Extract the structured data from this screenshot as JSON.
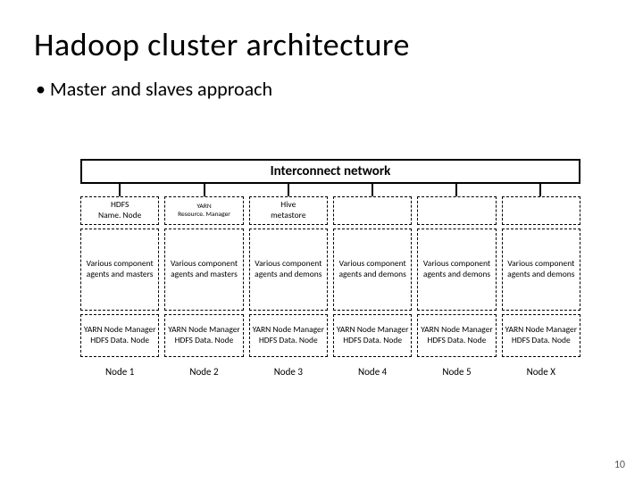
{
  "title": "Hadoop cluster architecture",
  "bullet": "• Master and slaves approach",
  "interconnect": "Interconnect network",
  "head": {
    "c1a": "HDFS",
    "c1b": "Name. Node",
    "c2a": "YARN",
    "c2b": "Resource. Manager",
    "c3a": "Hive",
    "c3b": "metastore"
  },
  "mid": {
    "masters": "Various component agents and masters",
    "demons": "Various component agents and demons"
  },
  "foot": {
    "a": "YARN Node Manager",
    "b": "HDFS Data. Node"
  },
  "labels": [
    "Node 1",
    "Node 2",
    "Node 3",
    "Node 4",
    "Node 5",
    "Node X"
  ],
  "page": "10"
}
